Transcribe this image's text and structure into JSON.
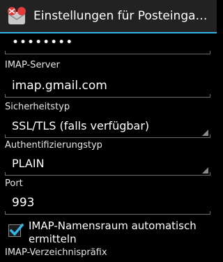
{
  "actionbar": {
    "title": "Einstellungen für Posteingangs…",
    "app_icon": "email-app-icon"
  },
  "password": {
    "value": "••••••••"
  },
  "imap_server": {
    "label": "IMAP-Server",
    "value": "imap.gmail.com"
  },
  "security": {
    "label": "Sicherheitstyp",
    "value": "SSL/TLS (falls verfügbar)"
  },
  "auth": {
    "label": "Authentifizierungstyp",
    "value": "PLAIN"
  },
  "port": {
    "label": "Port",
    "value": "993"
  },
  "namespace": {
    "label": "IMAP-Namensraum automatisch ermitteln",
    "checked": true
  },
  "prefix": {
    "label": "IMAP-Verzeichnispräfix"
  },
  "colors": {
    "accent": "#33b5e5",
    "background": "#000000",
    "actionbar": "#222222"
  }
}
